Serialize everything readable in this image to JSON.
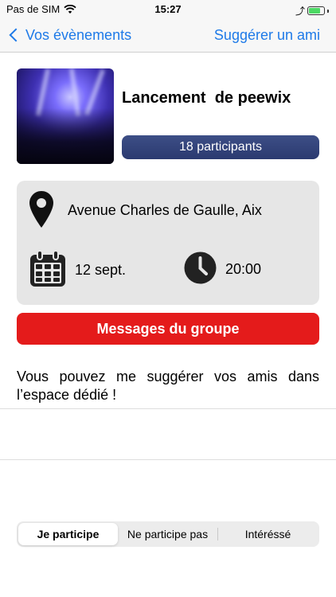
{
  "status_bar": {
    "carrier": "Pas de SIM",
    "time": "15:27"
  },
  "nav": {
    "back_label": "Vos évènements",
    "right_action": "Suggérer un ami"
  },
  "event": {
    "title": "Lancement  de peewix",
    "participants": "18 participants",
    "location": "Avenue Charles de Gaulle, Aix",
    "date": "12 sept.",
    "time": "20:00"
  },
  "actions": {
    "messages_button": "Messages du groupe"
  },
  "suggest_text": "Vous pouvez me suggérer vos amis dans l’espace dédié !",
  "segments": {
    "items": [
      "Je participe",
      "Ne participe pas",
      "Intéréssé"
    ],
    "selected": "Je participe"
  },
  "colors": {
    "accent_blue": "#1e7ae8",
    "participants_bg": "#2b3a70",
    "messages_red": "#e41b1b",
    "card_bg": "#e6e6e6",
    "battery_green": "#4cd964"
  }
}
